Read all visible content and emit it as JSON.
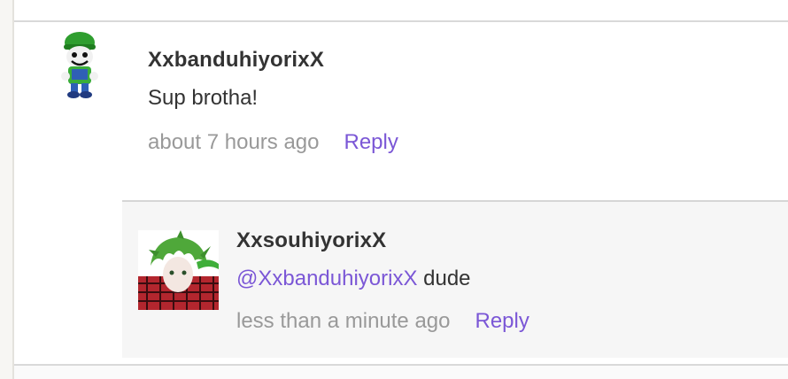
{
  "comment": {
    "username": "XxbanduhiyorixX",
    "text": "Sup brotha!",
    "time": "about 7 hours ago",
    "reply_label": "Reply",
    "avatar_icon": "luigi-avatar-icon"
  },
  "reply": {
    "username": "XxsouhiyorixX",
    "mention": "@XxbanduhiyorixX",
    "text": " dude",
    "time": "less than a minute ago",
    "reply_label": "Reply",
    "avatar_icon": "anime-avatar-icon"
  },
  "colors": {
    "link": "#7b57d6",
    "muted": "#999999",
    "text": "#333333",
    "reply_bg": "#f6f6f6"
  }
}
